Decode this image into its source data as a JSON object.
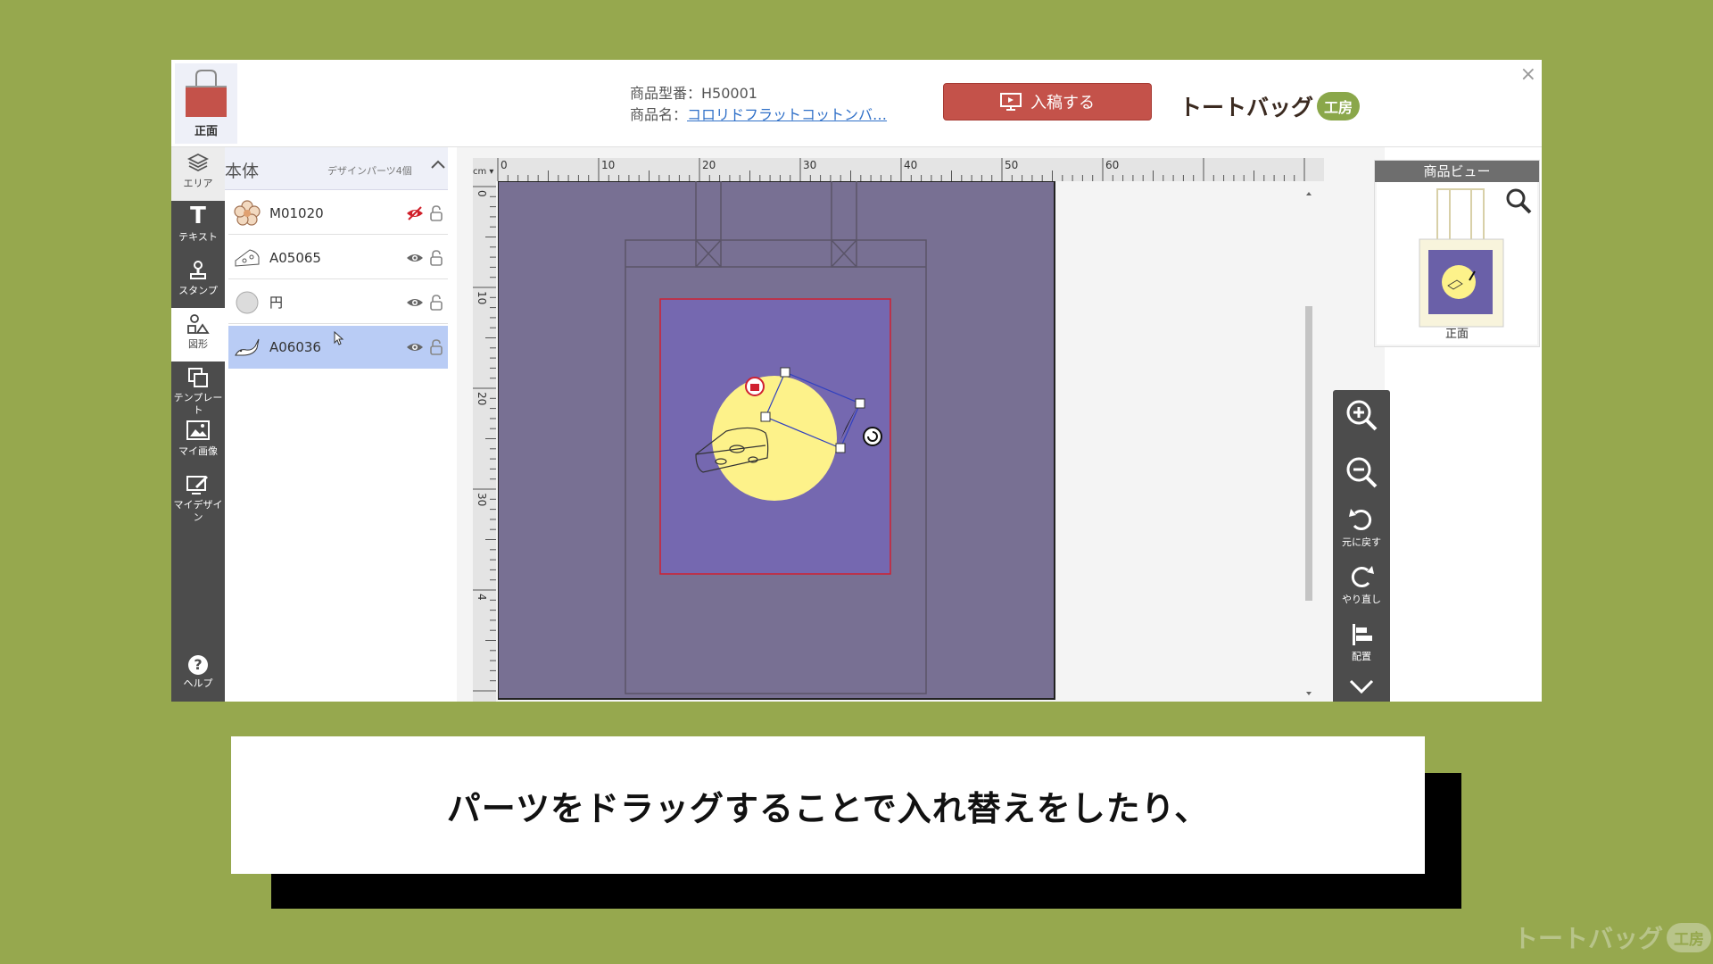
{
  "header": {
    "view_label": "正面",
    "product_code": "商品型番：H50001",
    "product_name_prefix": "商品名：",
    "product_name": "コロリドフラットコットンバ…",
    "submit_label": "入稿する",
    "logo_text": "トートバッグ",
    "logo_badge": "工房",
    "close": "×"
  },
  "toolbar": {
    "items": [
      {
        "label": "エリア",
        "icon": "layers-icon"
      },
      {
        "label": "テキスト",
        "icon": "text-icon"
      },
      {
        "label": "スタンプ",
        "icon": "stamp-icon"
      },
      {
        "label": "図形",
        "icon": "shapes-icon"
      },
      {
        "label": "テンプレート",
        "icon": "template-icon"
      },
      {
        "label": "マイ画像",
        "icon": "image-icon"
      },
      {
        "label": "マイデザイン",
        "icon": "my-design-icon"
      },
      {
        "label": "ヘルプ",
        "icon": "help-icon"
      }
    ],
    "text_glyph": "T",
    "help_glyph": "?"
  },
  "layers": {
    "title": "本体",
    "count": "デザインパーツ4個",
    "items": [
      {
        "name": "M01020",
        "visible": false
      },
      {
        "name": "A05065",
        "visible": true
      },
      {
        "name": "円",
        "visible": true
      },
      {
        "name": "A06036",
        "visible": true,
        "selected": true
      }
    ]
  },
  "ruler": {
    "unit": "cm",
    "top_labels": [
      "0",
      "10",
      "20",
      "30",
      "40",
      "50",
      "60"
    ],
    "left_labels": [
      "0",
      "10",
      "20",
      "30",
      "4"
    ]
  },
  "product_view": {
    "title": "商品ビュー",
    "label": "正面"
  },
  "zoom_panel": {
    "undo": "元に戻す",
    "redo": "やり直し",
    "align": "配置"
  },
  "caption": "パーツをドラッグすることで入れ替えをしたり、",
  "watermark": {
    "text": "トートバッグ",
    "badge": "工房"
  },
  "colors": {
    "accent": "#c4524a",
    "canvas": "#787093",
    "print_area": "#7568b0",
    "circle": "#fdf28a",
    "background": "#96a84e"
  }
}
